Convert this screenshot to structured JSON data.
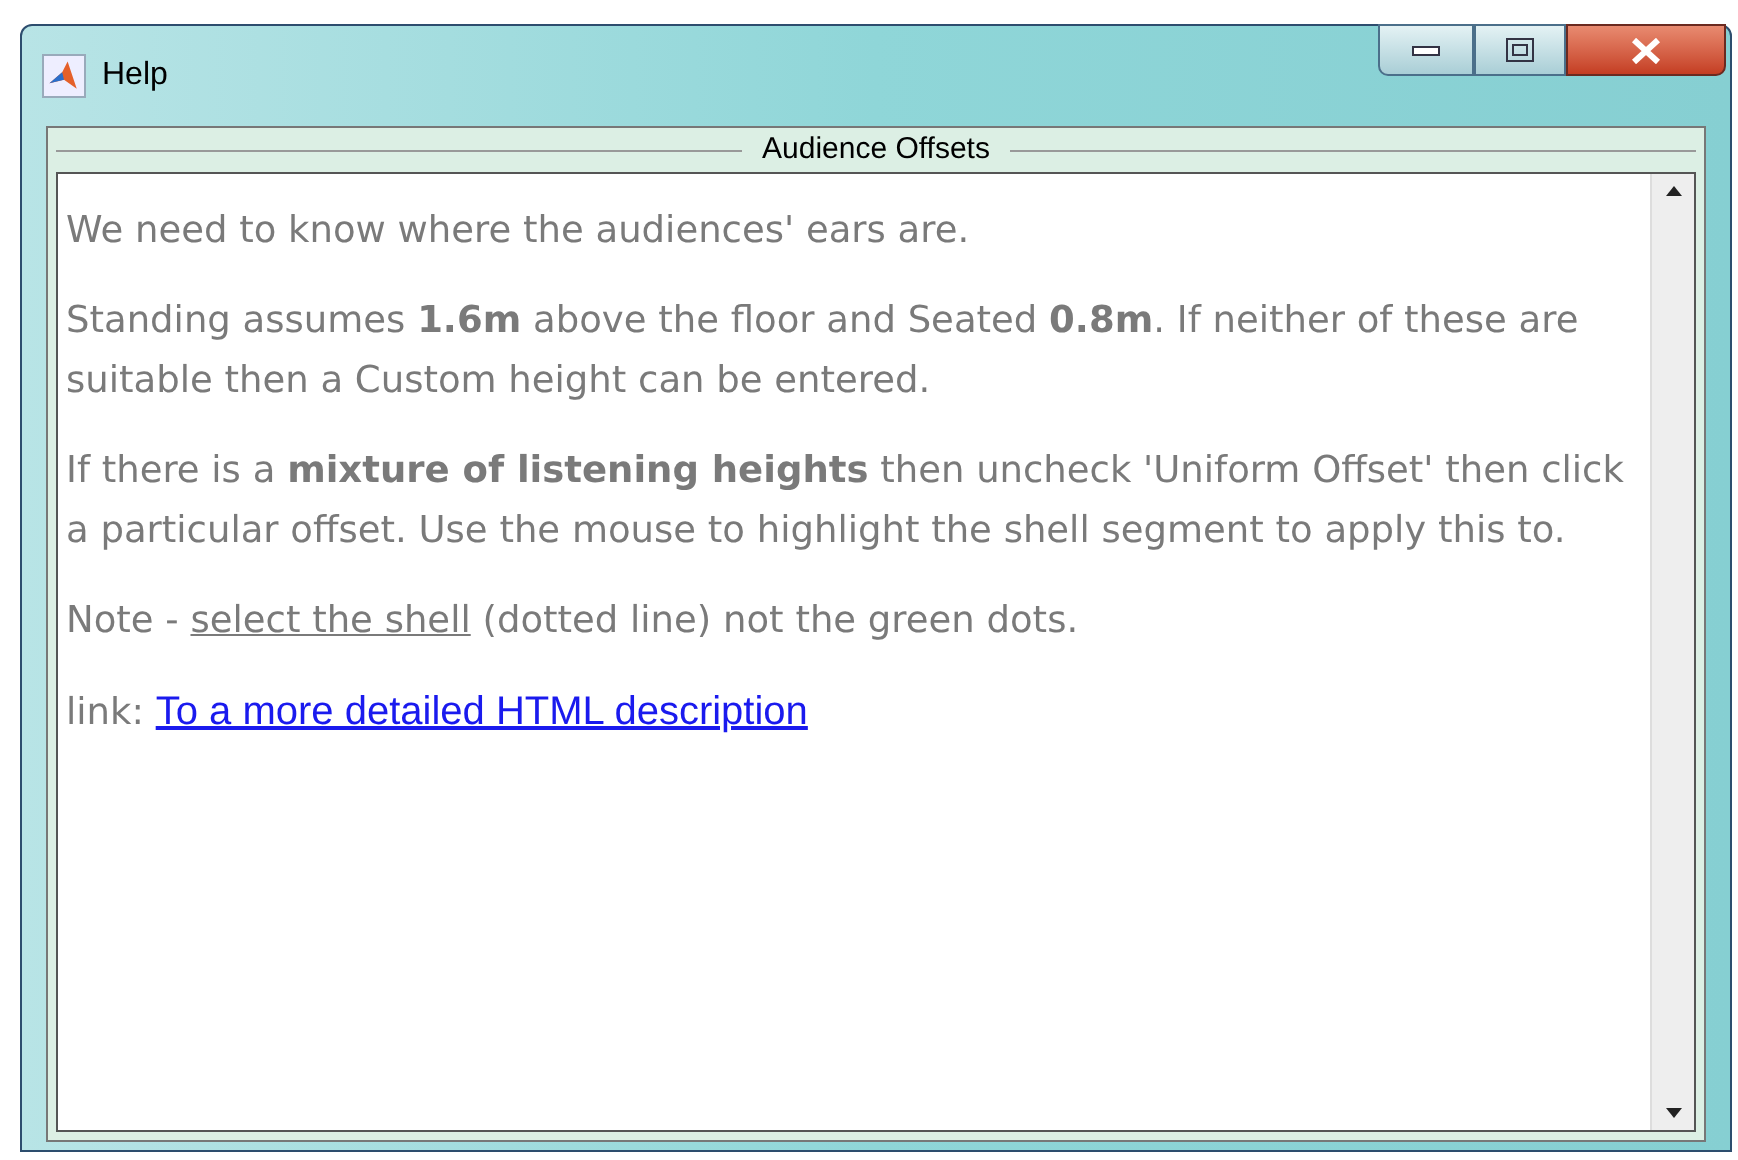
{
  "window": {
    "title": "Help"
  },
  "panel": {
    "title": "Audience Offsets"
  },
  "paragraphs": [
    {
      "parts": [
        {
          "kind": "text",
          "text": "We need to know where the audiences' ears are."
        }
      ]
    },
    {
      "parts": [
        {
          "kind": "text",
          "text": "Standing assumes **1.6m** above the floor and Seated **0.8m**. If neither of these are suitable then a Custom height can be entered."
        }
      ]
    },
    {
      "parts": [
        {
          "kind": "text",
          "text": "If there is a **mixture of listening heights** then uncheck 'Uniform Offset' then click a particular offset.  Use the mouse to highlight the shell segment to apply this to."
        }
      ]
    },
    {
      "parts": [
        {
          "kind": "text",
          "text": "Note - "
        },
        {
          "kind": "underlined",
          "text": "select the shell"
        },
        {
          "kind": "text",
          "text": " (dotted line) not the green dots."
        }
      ]
    },
    {
      "parts": [
        {
          "kind": "text",
          "text": "link: "
        },
        {
          "kind": "link",
          "text": "To a more detailed HTML description"
        }
      ]
    }
  ]
}
